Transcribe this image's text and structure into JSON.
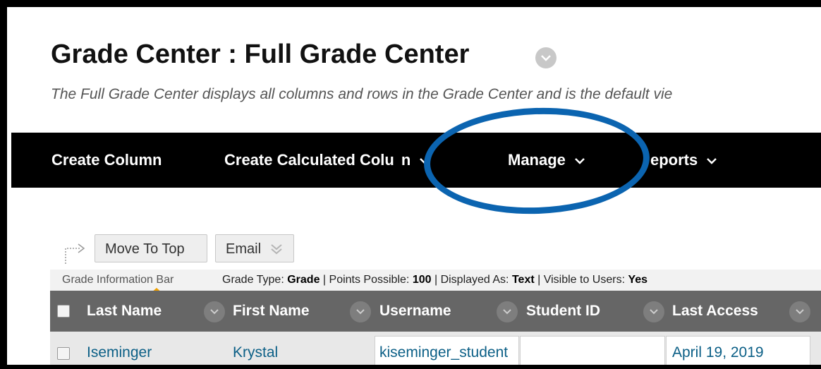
{
  "page": {
    "title": "Grade Center : Full Grade Center",
    "description": "The Full Grade Center displays all columns and rows in the Grade Center and is the default vie"
  },
  "action_bar": {
    "items": [
      {
        "label": "Create Column"
      },
      {
        "label": "Create Calculated Colu",
        "label_tail": "n"
      },
      {
        "label": "Manage"
      },
      {
        "label": "eports"
      }
    ]
  },
  "toolbar": {
    "move_to_top": "Move To Top",
    "email": "Email"
  },
  "grade_info": {
    "label": "Grade Information Bar",
    "grade_type_label": "Grade Type:",
    "grade_type": "Grade",
    "points_label": "Points Possible:",
    "points": "100",
    "displayed_label": "Displayed As:",
    "displayed": "Text",
    "visible_label": "Visible to Users:",
    "visible": "Yes"
  },
  "table": {
    "columns": [
      "Last Name",
      "First Name",
      "Username",
      "Student ID",
      "Last Access"
    ],
    "rows": [
      {
        "last_name": "Iseminger",
        "first_name": "Krystal",
        "username": "kiseminger_student",
        "student_id": "",
        "last_access": "April 19, 2019"
      }
    ]
  },
  "colors": {
    "action_bar_bg": "#000000",
    "highlight_ring": "#0b64b0",
    "header_bg": "#666666",
    "link_text": "#0b5f86"
  }
}
